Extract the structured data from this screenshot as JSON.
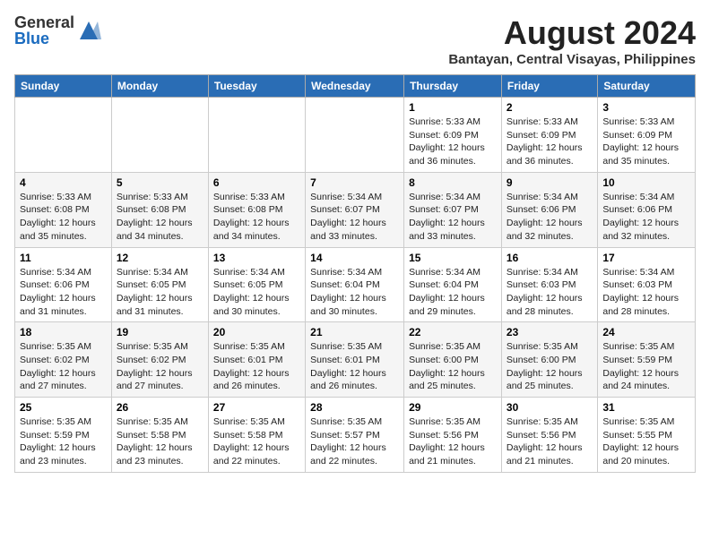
{
  "header": {
    "logo_general": "General",
    "logo_blue": "Blue",
    "month_year": "August 2024",
    "location": "Bantayan, Central Visayas, Philippines"
  },
  "weekdays": [
    "Sunday",
    "Monday",
    "Tuesday",
    "Wednesday",
    "Thursday",
    "Friday",
    "Saturday"
  ],
  "weeks": [
    [
      {
        "day": "",
        "info": ""
      },
      {
        "day": "",
        "info": ""
      },
      {
        "day": "",
        "info": ""
      },
      {
        "day": "",
        "info": ""
      },
      {
        "day": "1",
        "info": "Sunrise: 5:33 AM\nSunset: 6:09 PM\nDaylight: 12 hours\nand 36 minutes."
      },
      {
        "day": "2",
        "info": "Sunrise: 5:33 AM\nSunset: 6:09 PM\nDaylight: 12 hours\nand 36 minutes."
      },
      {
        "day": "3",
        "info": "Sunrise: 5:33 AM\nSunset: 6:09 PM\nDaylight: 12 hours\nand 35 minutes."
      }
    ],
    [
      {
        "day": "4",
        "info": "Sunrise: 5:33 AM\nSunset: 6:08 PM\nDaylight: 12 hours\nand 35 minutes."
      },
      {
        "day": "5",
        "info": "Sunrise: 5:33 AM\nSunset: 6:08 PM\nDaylight: 12 hours\nand 34 minutes."
      },
      {
        "day": "6",
        "info": "Sunrise: 5:33 AM\nSunset: 6:08 PM\nDaylight: 12 hours\nand 34 minutes."
      },
      {
        "day": "7",
        "info": "Sunrise: 5:34 AM\nSunset: 6:07 PM\nDaylight: 12 hours\nand 33 minutes."
      },
      {
        "day": "8",
        "info": "Sunrise: 5:34 AM\nSunset: 6:07 PM\nDaylight: 12 hours\nand 33 minutes."
      },
      {
        "day": "9",
        "info": "Sunrise: 5:34 AM\nSunset: 6:06 PM\nDaylight: 12 hours\nand 32 minutes."
      },
      {
        "day": "10",
        "info": "Sunrise: 5:34 AM\nSunset: 6:06 PM\nDaylight: 12 hours\nand 32 minutes."
      }
    ],
    [
      {
        "day": "11",
        "info": "Sunrise: 5:34 AM\nSunset: 6:06 PM\nDaylight: 12 hours\nand 31 minutes."
      },
      {
        "day": "12",
        "info": "Sunrise: 5:34 AM\nSunset: 6:05 PM\nDaylight: 12 hours\nand 31 minutes."
      },
      {
        "day": "13",
        "info": "Sunrise: 5:34 AM\nSunset: 6:05 PM\nDaylight: 12 hours\nand 30 minutes."
      },
      {
        "day": "14",
        "info": "Sunrise: 5:34 AM\nSunset: 6:04 PM\nDaylight: 12 hours\nand 30 minutes."
      },
      {
        "day": "15",
        "info": "Sunrise: 5:34 AM\nSunset: 6:04 PM\nDaylight: 12 hours\nand 29 minutes."
      },
      {
        "day": "16",
        "info": "Sunrise: 5:34 AM\nSunset: 6:03 PM\nDaylight: 12 hours\nand 28 minutes."
      },
      {
        "day": "17",
        "info": "Sunrise: 5:34 AM\nSunset: 6:03 PM\nDaylight: 12 hours\nand 28 minutes."
      }
    ],
    [
      {
        "day": "18",
        "info": "Sunrise: 5:35 AM\nSunset: 6:02 PM\nDaylight: 12 hours\nand 27 minutes."
      },
      {
        "day": "19",
        "info": "Sunrise: 5:35 AM\nSunset: 6:02 PM\nDaylight: 12 hours\nand 27 minutes."
      },
      {
        "day": "20",
        "info": "Sunrise: 5:35 AM\nSunset: 6:01 PM\nDaylight: 12 hours\nand 26 minutes."
      },
      {
        "day": "21",
        "info": "Sunrise: 5:35 AM\nSunset: 6:01 PM\nDaylight: 12 hours\nand 26 minutes."
      },
      {
        "day": "22",
        "info": "Sunrise: 5:35 AM\nSunset: 6:00 PM\nDaylight: 12 hours\nand 25 minutes."
      },
      {
        "day": "23",
        "info": "Sunrise: 5:35 AM\nSunset: 6:00 PM\nDaylight: 12 hours\nand 25 minutes."
      },
      {
        "day": "24",
        "info": "Sunrise: 5:35 AM\nSunset: 5:59 PM\nDaylight: 12 hours\nand 24 minutes."
      }
    ],
    [
      {
        "day": "25",
        "info": "Sunrise: 5:35 AM\nSunset: 5:59 PM\nDaylight: 12 hours\nand 23 minutes."
      },
      {
        "day": "26",
        "info": "Sunrise: 5:35 AM\nSunset: 5:58 PM\nDaylight: 12 hours\nand 23 minutes."
      },
      {
        "day": "27",
        "info": "Sunrise: 5:35 AM\nSunset: 5:58 PM\nDaylight: 12 hours\nand 22 minutes."
      },
      {
        "day": "28",
        "info": "Sunrise: 5:35 AM\nSunset: 5:57 PM\nDaylight: 12 hours\nand 22 minutes."
      },
      {
        "day": "29",
        "info": "Sunrise: 5:35 AM\nSunset: 5:56 PM\nDaylight: 12 hours\nand 21 minutes."
      },
      {
        "day": "30",
        "info": "Sunrise: 5:35 AM\nSunset: 5:56 PM\nDaylight: 12 hours\nand 21 minutes."
      },
      {
        "day": "31",
        "info": "Sunrise: 5:35 AM\nSunset: 5:55 PM\nDaylight: 12 hours\nand 20 minutes."
      }
    ]
  ]
}
